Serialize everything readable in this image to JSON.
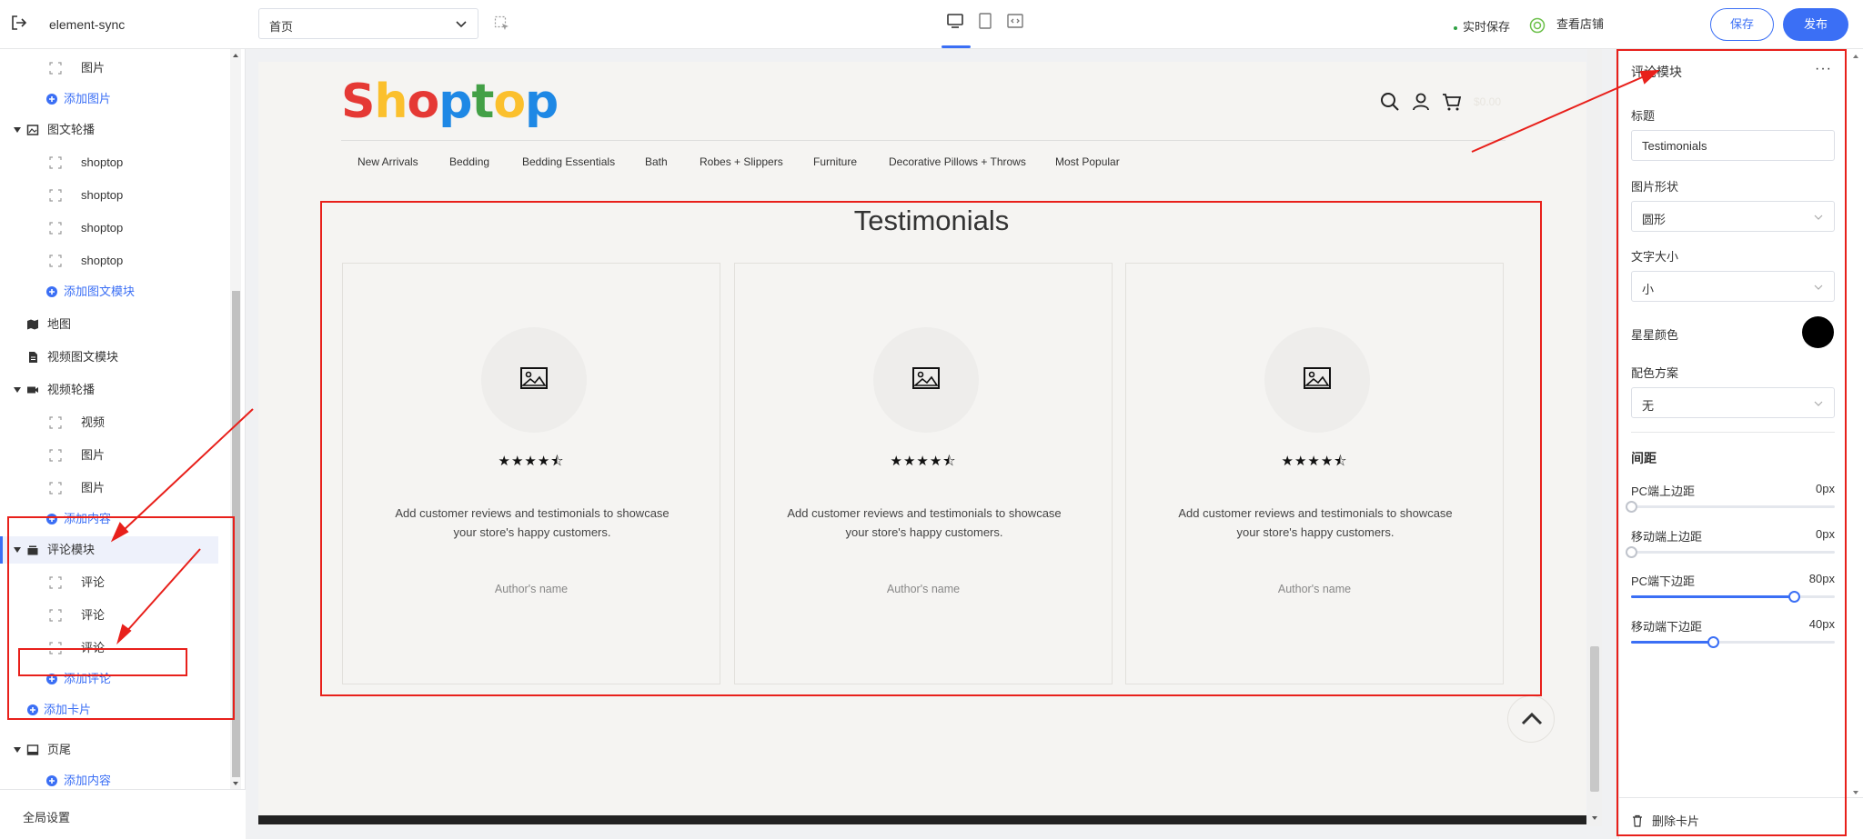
{
  "app": {
    "name": "element-sync"
  },
  "toolbar": {
    "page_select": "首页",
    "autosave_label": "实时保存",
    "view_store_label": "查看店铺",
    "save_label": "保存",
    "publish_label": "发布"
  },
  "sidebar": {
    "items": [
      {
        "label": "图片",
        "kind": "child"
      },
      {
        "label": "添加图片",
        "kind": "add"
      },
      {
        "label": "图文轮播",
        "kind": "section"
      },
      {
        "label": "shoptop",
        "kind": "child"
      },
      {
        "label": "shoptop",
        "kind": "child"
      },
      {
        "label": "shoptop",
        "kind": "child"
      },
      {
        "label": "shoptop",
        "kind": "child"
      },
      {
        "label": "添加图文模块",
        "kind": "add"
      },
      {
        "label": "地图",
        "kind": "section"
      },
      {
        "label": "视频图文模块",
        "kind": "section"
      },
      {
        "label": "视频轮播",
        "kind": "section"
      },
      {
        "label": "视频",
        "kind": "child"
      },
      {
        "label": "图片",
        "kind": "child"
      },
      {
        "label": "图片",
        "kind": "child"
      },
      {
        "label": "添加内容",
        "kind": "add"
      },
      {
        "label": "评论模块",
        "kind": "section",
        "selected": true
      },
      {
        "label": "评论",
        "kind": "child"
      },
      {
        "label": "评论",
        "kind": "child"
      },
      {
        "label": "评论",
        "kind": "child"
      },
      {
        "label": "添加评论",
        "kind": "add"
      },
      {
        "label": "添加卡片",
        "kind": "add"
      },
      {
        "label": "页尾",
        "kind": "section"
      },
      {
        "label": "添加内容",
        "kind": "add"
      }
    ],
    "footer_label": "全局设置"
  },
  "store": {
    "logo_letters": [
      {
        "ch": "S",
        "color": "#e53935"
      },
      {
        "ch": "h",
        "color": "#fbc02d"
      },
      {
        "ch": "o",
        "color": "#e53935"
      },
      {
        "ch": "p",
        "color": "#1e88e5"
      },
      {
        "ch": "t",
        "color": "#43a047"
      },
      {
        "ch": "o",
        "color": "#fbc02d"
      },
      {
        "ch": "p",
        "color": "#1e88e5"
      }
    ],
    "cart_amount": "$0.00",
    "nav": [
      "New Arrivals",
      "Bedding",
      "Bedding Essentials",
      "Bath",
      "Robes + Slippers",
      "Furniture",
      "Decorative Pillows + Throws",
      "Most Popular"
    ],
    "testimonials_title": "Testimonials",
    "cards": [
      {
        "rating": 4.5,
        "stars": "★★★★⯪",
        "text": "Add customer reviews and testimonials to showcase your store's happy customers.",
        "author": "Author's name"
      },
      {
        "rating": 4.5,
        "stars": "★★★★⯪",
        "text": "Add customer reviews and testimonials to showcase your store's happy customers.",
        "author": "Author's name"
      },
      {
        "rating": 4.5,
        "stars": "★★★★⯪",
        "text": "Add customer reviews and testimonials to showcase your store's happy customers.",
        "author": "Author's name"
      }
    ]
  },
  "panel": {
    "title": "评论模块",
    "title_field": {
      "label": "标题",
      "value": "Testimonials"
    },
    "image_shape": {
      "label": "图片形状",
      "value": "圆形"
    },
    "text_size": {
      "label": "文字大小",
      "value": "小"
    },
    "star_color": {
      "label": "星星颜色",
      "color": "#000000"
    },
    "color_scheme": {
      "label": "配色方案",
      "value": "无"
    },
    "spacing_title": "间距",
    "sliders": [
      {
        "label": "PC端上边距",
        "value_text": "0px",
        "value": 0,
        "max": 100
      },
      {
        "label": "移动端上边距",
        "value_text": "0px",
        "value": 0,
        "max": 100
      },
      {
        "label": "PC端下边距",
        "value_text": "80px",
        "value": 80,
        "max": 100
      },
      {
        "label": "移动端下边距",
        "value_text": "40px",
        "value": 40,
        "max": 100
      }
    ],
    "delete_label": "删除卡片"
  },
  "colors": {
    "accent": "#3b6ff5",
    "annotation": "#e8201b"
  }
}
